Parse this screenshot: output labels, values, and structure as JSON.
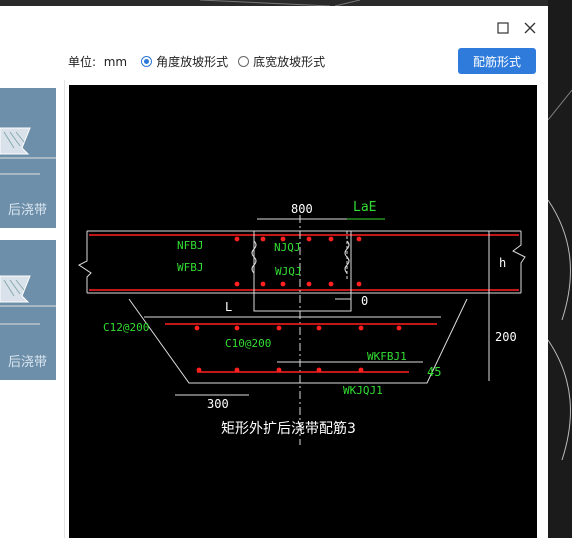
{
  "dialog": {
    "unit_label": "单位:",
    "unit_value": "mm",
    "options": [
      {
        "label": "角度放坡形式",
        "selected": true
      },
      {
        "label": "底宽放坡形式",
        "selected": false
      }
    ],
    "action_button": "配筋形式"
  },
  "thumbnails": [
    {
      "caption": "后浇带"
    },
    {
      "caption": "后浇带"
    }
  ],
  "drawing": {
    "dim_800": "800",
    "dim_lae": "LaE",
    "dim_l": "L",
    "dim_h": "h",
    "dim_0": "0",
    "dim_200": "200",
    "dim_300": "300",
    "dim_45": "45",
    "label_nfbj": "NFBJ",
    "label_njqj": "NJQJ",
    "label_wfbj": "WFBJ",
    "label_wjqj": "WJQJ",
    "label_c12": "C12@200",
    "label_c10": "C10@200",
    "label_wkfbj": "WKFBJ1",
    "label_wkjqj": "WKJQJ1",
    "caption": "矩形外扩后浇带配筋3"
  },
  "colors": {
    "accent": "#2f7bdc",
    "rebar": "#ff2020",
    "dim": "#ffffff",
    "label": "#33dd33"
  }
}
